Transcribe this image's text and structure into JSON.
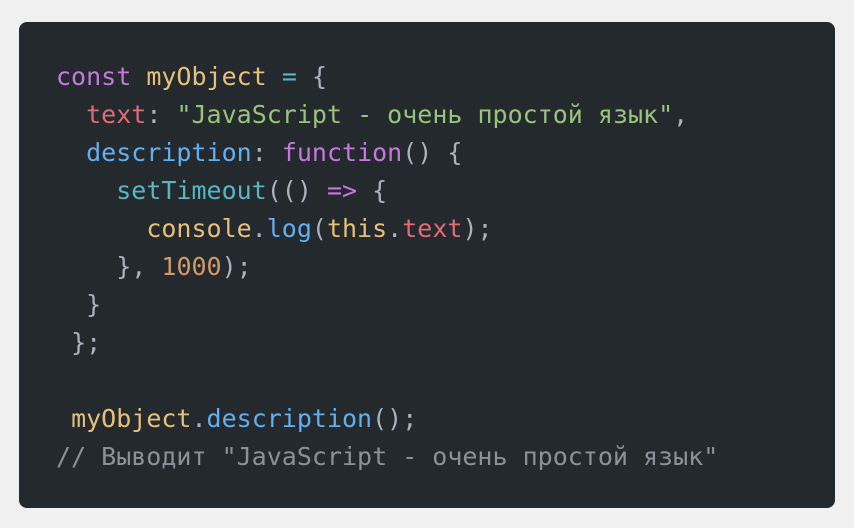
{
  "code": {
    "line1": {
      "kw": "const",
      "name": "myObject",
      "op": "=",
      "brace": "{"
    },
    "line2": {
      "prop": "text",
      "colon": ":",
      "str": "\"JavaScript - очень простой язык\"",
      "comma": ","
    },
    "line3": {
      "prop": "description",
      "colon": ":",
      "kw": "function",
      "parens": "()",
      "brace": "{"
    },
    "line4": {
      "fn": "setTimeout",
      "open": "((",
      "close": ")",
      "arrow": "=>",
      "brace": "{"
    },
    "line5": {
      "obj": "console",
      "dot": ".",
      "fn": "log",
      "open": "(",
      "kw": "this",
      "dot2": ".",
      "prop": "text",
      "close": ");"
    },
    "line6": {
      "close": "},",
      "num": "1000",
      "end": ");"
    },
    "line7": {
      "brace": "}"
    },
    "line8": {
      "brace": "};"
    },
    "line10": {
      "obj": "myObject",
      "dot": ".",
      "fn": "description",
      "call": "();"
    },
    "line11": {
      "comment": "// Выводит \"JavaScript - очень простой язык\""
    }
  }
}
